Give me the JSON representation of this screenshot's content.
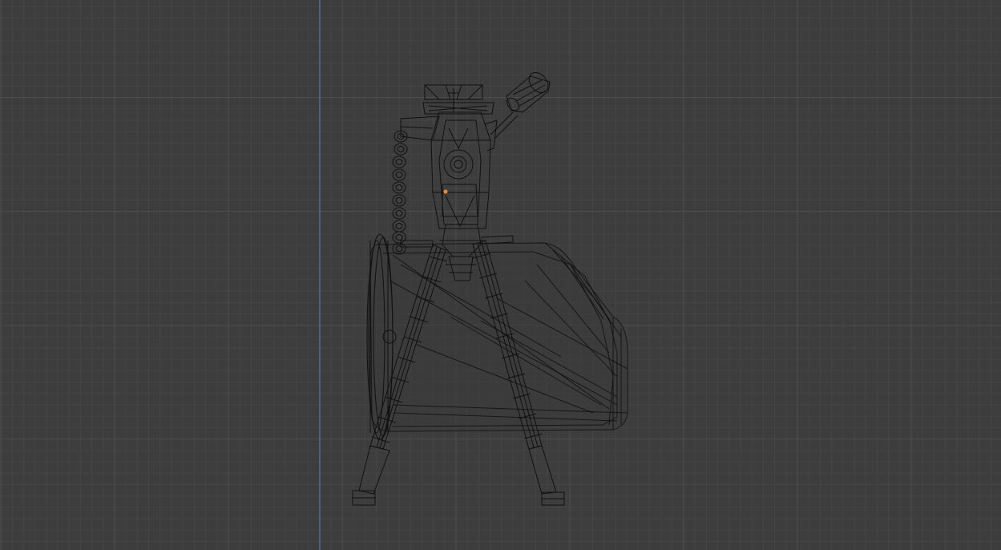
{
  "viewport": {
    "view": "wireframe",
    "background_color": "#3d3d3d",
    "grid_minor_color": "#454545",
    "grid_major_color": "#4f4f4f",
    "axis_line_color": "#5a73a8",
    "wire_color": "#111111",
    "origin_color": "#f08a28"
  },
  "object": {
    "name_icon": "mounted-machine-gun-model",
    "parts": [
      "gun-body",
      "ammo-belt",
      "ammo-box",
      "bipod-left-leg",
      "bipod-right-leg",
      "top-sight",
      "scope"
    ]
  }
}
